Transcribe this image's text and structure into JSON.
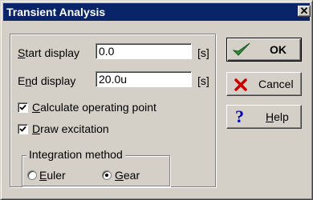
{
  "window": {
    "title": "Transient Analysis",
    "close_glyph": "✕"
  },
  "form": {
    "start_display": {
      "label_access": "S",
      "label_rest": "tart display",
      "value": "0.0",
      "unit": "[s]"
    },
    "end_display": {
      "label_first": "E",
      "label_access": "n",
      "label_rest": "d display",
      "value": "20.0u",
      "unit": "[s]"
    },
    "calculate_operating_point": {
      "label_access": "C",
      "label_rest": "alculate operating point",
      "checked": true
    },
    "draw_excitation": {
      "label_access": "D",
      "label_rest": "raw excitation",
      "checked": true
    },
    "integration_method": {
      "title": "Integration method",
      "options": [
        {
          "label_access": "E",
          "label_rest": "uler",
          "selected": false
        },
        {
          "label_access": "G",
          "label_rest": "ear",
          "selected": true
        }
      ]
    }
  },
  "buttons": {
    "ok": {
      "label": "OK",
      "icon": "checkmark-icon",
      "color": "#2e8b3a"
    },
    "cancel": {
      "label": "Cancel",
      "icon": "x-icon",
      "color": "#cc0000"
    },
    "help": {
      "label_access": "H",
      "label_rest": "elp",
      "icon": "question-icon",
      "color": "#0000cc"
    }
  }
}
